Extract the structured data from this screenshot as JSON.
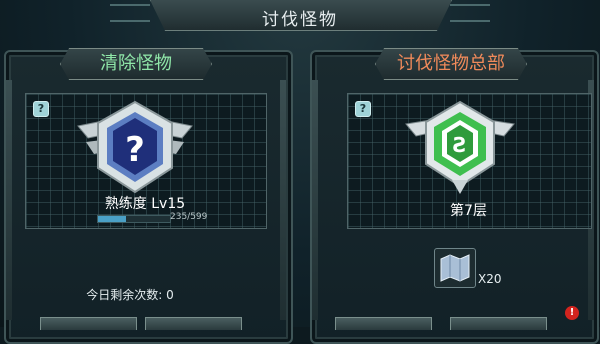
{
  "header": {
    "title": "讨伐怪物"
  },
  "left_panel": {
    "title": "清除怪物",
    "help": "?",
    "badge_icon": "question-shield-icon",
    "level_label": "熟练度 Lv15",
    "progress_text": "235/599",
    "progress_fraction": 0.392,
    "remaining_label": "今日剩余次数: 0"
  },
  "right_panel": {
    "title": "讨伐怪物总部",
    "help": "?",
    "badge_icon": "green-emblem-shield-icon",
    "floor_label": "第7层",
    "reward_item_icon": "map-scroll-icon",
    "reward_qty": "X20"
  },
  "colors": {
    "left_title": "#8fe6a8",
    "right_title": "#f08a5a",
    "progress": "#4aa0c6",
    "emblem_green": "#3fbf4f"
  },
  "alert": {
    "icon": "alert-icon",
    "glyph": "!"
  }
}
